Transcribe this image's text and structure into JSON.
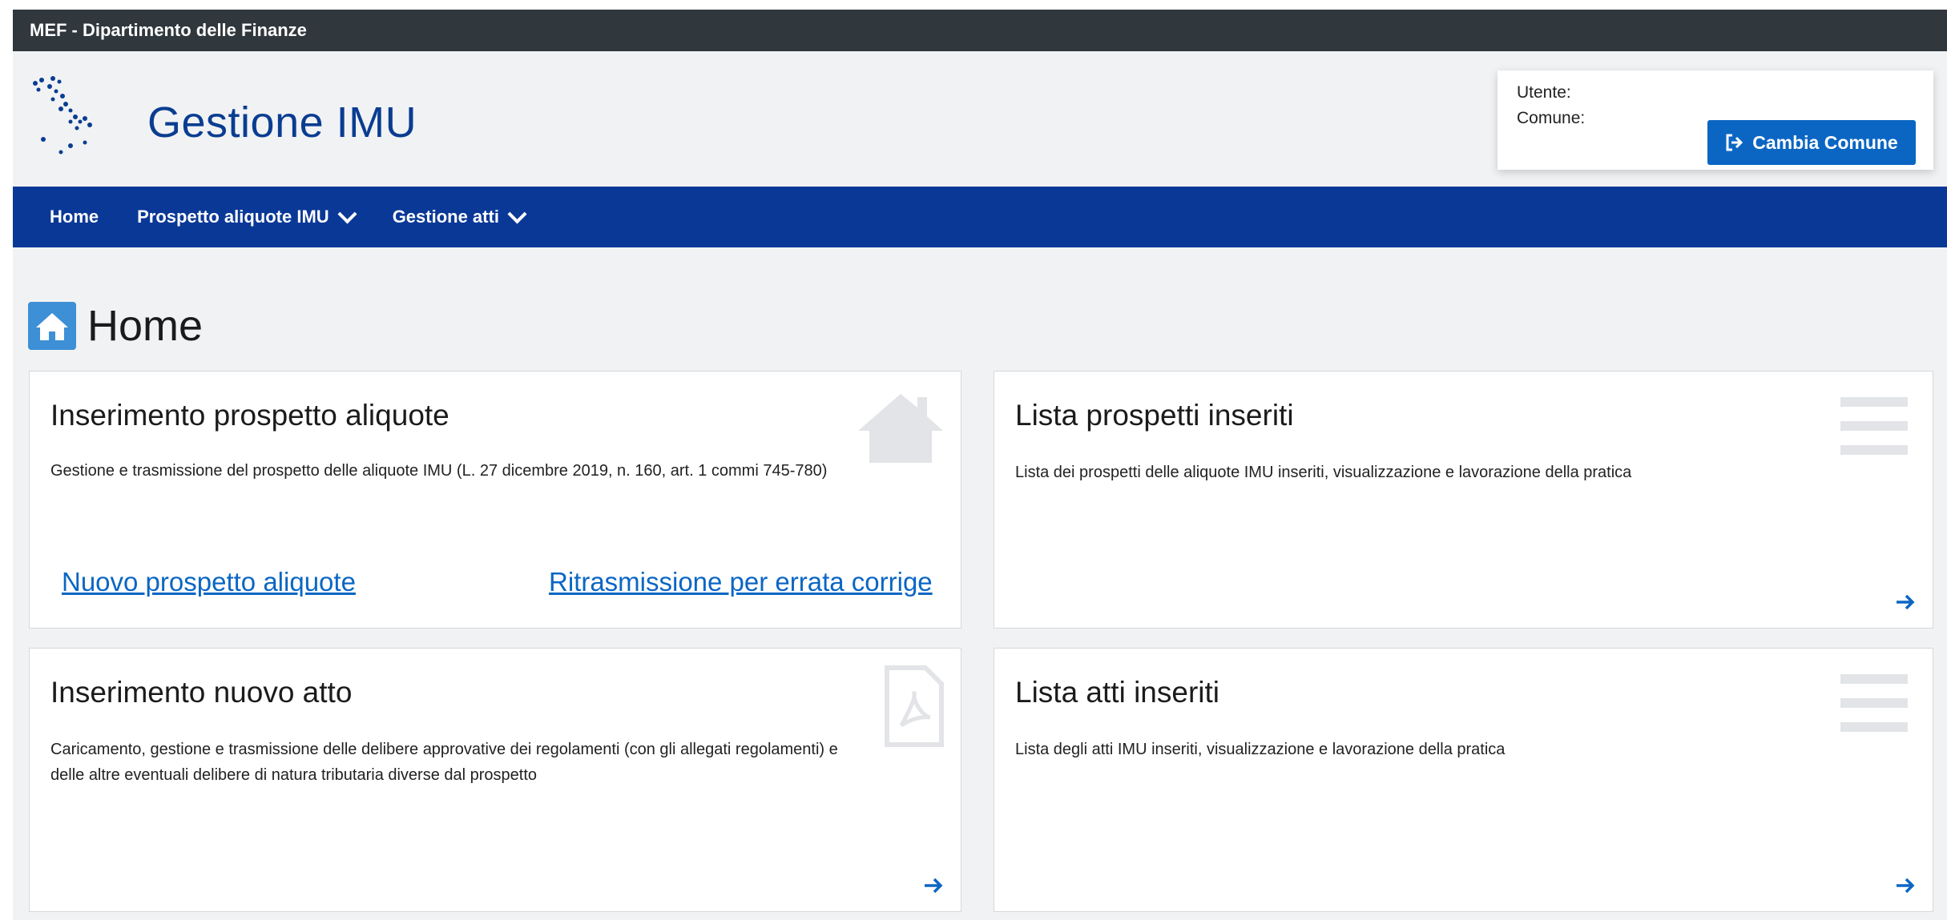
{
  "slim_header": {
    "title": "MEF - Dipartimento delle Finanze"
  },
  "brand": {
    "title": "Gestione IMU"
  },
  "user_box": {
    "user_label": "Utente:",
    "comune_label": "Comune:",
    "change_button": "Cambia Comune"
  },
  "nav": {
    "items": [
      {
        "label": "Home",
        "has_dropdown": false
      },
      {
        "label": "Prospetto aliquote IMU",
        "has_dropdown": true
      },
      {
        "label": "Gestione atti",
        "has_dropdown": true
      }
    ]
  },
  "page": {
    "title": "Home"
  },
  "cards": [
    {
      "title": "Inserimento prospetto aliquote",
      "text": "Gestione e trasmissione del prospetto delle aliquote IMU (L. 27 dicembre 2019, n. 160, art. 1 commi 745-780)",
      "icon": "home-icon",
      "links": [
        "Nuovo prospetto aliquote",
        "Ritrasmissione per errata corrige"
      ]
    },
    {
      "title": "Lista prospetti inseriti",
      "text": "Lista dei prospetti delle aliquote IMU inseriti, visualizzazione e lavorazione della pratica",
      "icon": "list-icon"
    },
    {
      "title": "Inserimento nuovo atto",
      "text": "Caricamento, gestione e trasmissione delle delibere approvative dei regolamenti (con gli allegati regolamenti) e delle altre eventuali delibere di natura tributaria diverse dal prospetto",
      "icon": "pdf-file-icon"
    },
    {
      "title": "Lista atti inseriti",
      "text": "Lista degli atti IMU inseriti, visualizzazione e lavorazione della pratica",
      "icon": "list-icon"
    }
  ],
  "colors": {
    "slim_header_bg": "#30373d",
    "brand_blue": "#0a3d91",
    "nav_bg": "#0a3897",
    "primary_button": "#0b66c3",
    "page_bg": "#f1f2f4"
  }
}
